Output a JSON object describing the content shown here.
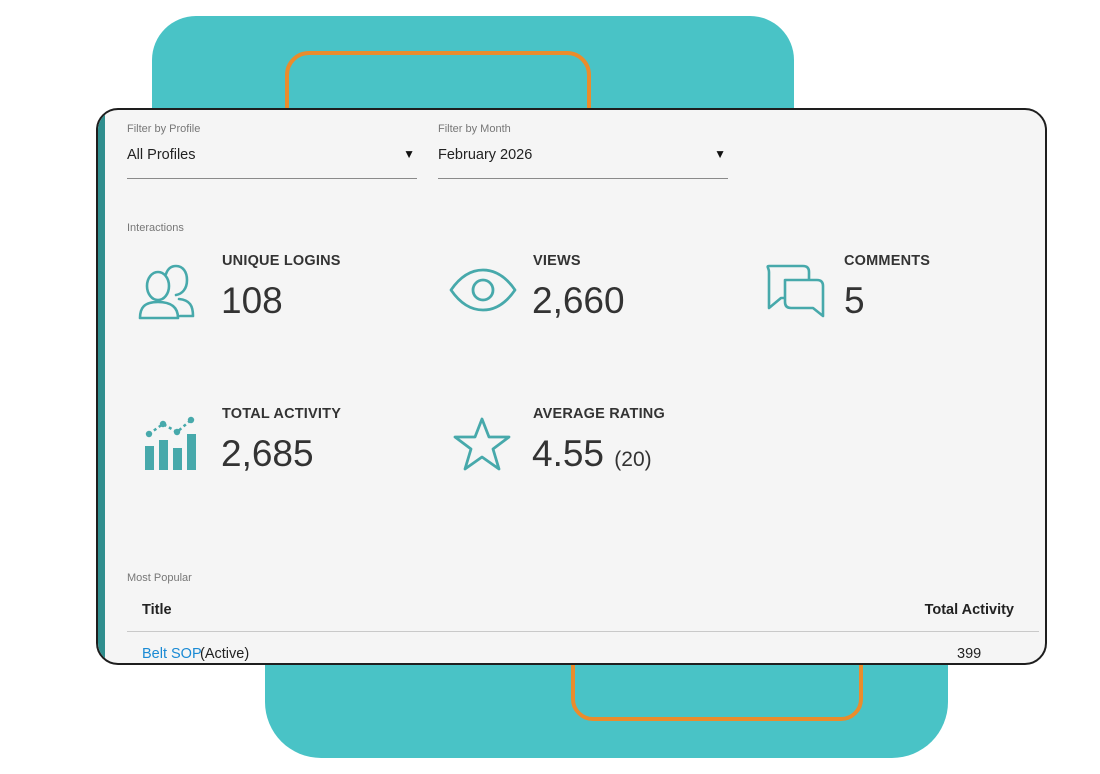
{
  "filters": {
    "profile": {
      "label": "Filter by Profile",
      "value": "All Profiles",
      "arrow": "▼"
    },
    "month": {
      "label": "Filter by Month",
      "value": "February 2026",
      "arrow": "▼"
    }
  },
  "interactions": {
    "section_label": "Interactions",
    "unique_logins": {
      "title": "UNIQUE LOGINS",
      "value": "108",
      "icon": "users-icon"
    },
    "views": {
      "title": "VIEWS",
      "value": "2,660",
      "icon": "eye-icon"
    },
    "comments": {
      "title": "COMMENTS",
      "value": "5",
      "icon": "comments-icon"
    },
    "total_activity": {
      "title": "TOTAL ACTIVITY",
      "value": "2,685",
      "icon": "activity-chart-icon"
    },
    "average_rating": {
      "title": "AVERAGE RATING",
      "value": "4.55",
      "count": "(20)",
      "icon": "star-icon"
    }
  },
  "most_popular": {
    "section_label": "Most Popular",
    "columns": {
      "title": "Title",
      "total": "Total Activity"
    },
    "rows": [
      {
        "title": "Belt SOP",
        "status": "(Active)",
        "total": "399"
      }
    ]
  },
  "colors": {
    "teal": "#49c3c6",
    "orange": "#ea8c2c",
    "icon_teal": "#47a9ab",
    "link_blue": "#1a8ad4",
    "accent_bar": "#2f8e8e"
  }
}
